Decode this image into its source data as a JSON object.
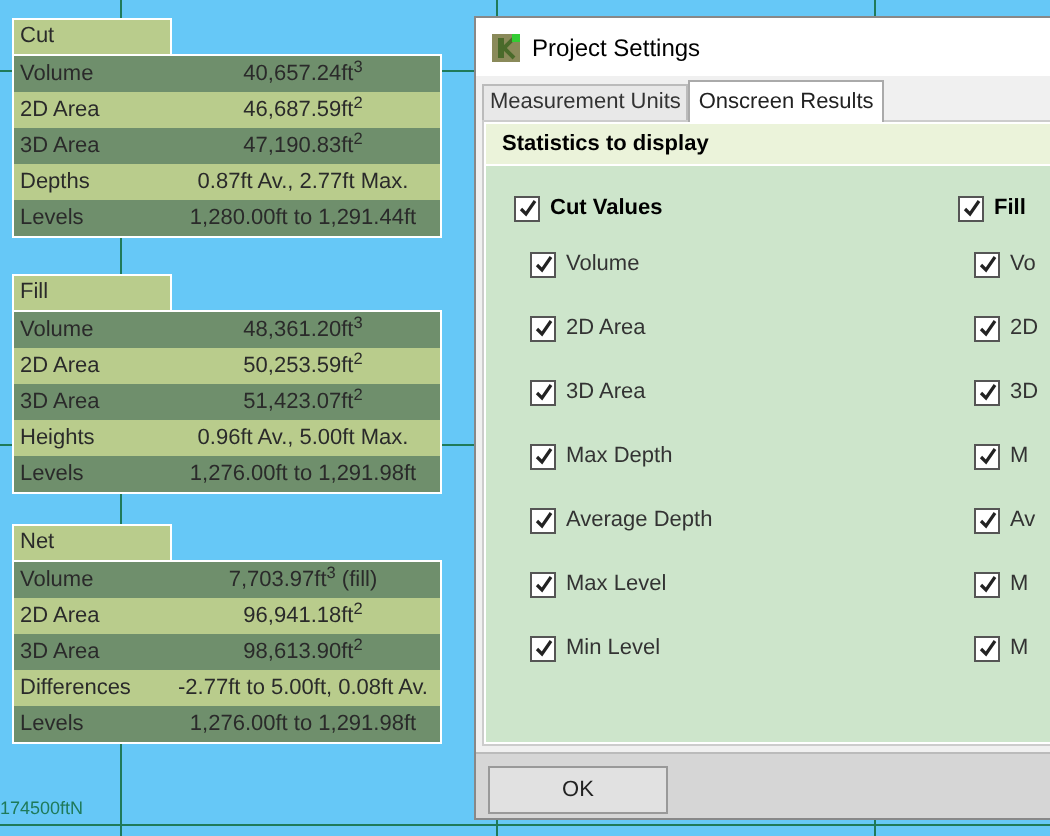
{
  "map": {
    "grid_label": "174500ftN"
  },
  "results": [
    {
      "title": "Cut",
      "rows": [
        {
          "label": "Volume",
          "value": "40,657.24ft$^{3}$"
        },
        {
          "label": "2D Area",
          "value": "46,687.59ft$^{2}$"
        },
        {
          "label": "3D Area",
          "value": "47,190.83ft$^{2}$"
        },
        {
          "label": "Depths",
          "value": "0.87ft Av., 2.77ft Max."
        },
        {
          "label": "Levels",
          "value": "1,280.00ft to 1,291.44ft"
        }
      ]
    },
    {
      "title": "Fill",
      "rows": [
        {
          "label": "Volume",
          "value": "48,361.20ft$^{3}$"
        },
        {
          "label": "2D Area",
          "value": "50,253.59ft$^{2}$"
        },
        {
          "label": "3D Area",
          "value": "51,423.07ft$^{2}$"
        },
        {
          "label": "Heights",
          "value": "0.96ft Av., 5.00ft Max."
        },
        {
          "label": "Levels",
          "value": "1,276.00ft to 1,291.98ft"
        }
      ]
    },
    {
      "title": "Net",
      "rows": [
        {
          "label": "Volume",
          "value": "7,703.97ft$^{3}$ (fill)"
        },
        {
          "label": "2D Area",
          "value": "96,941.18ft$^{2}$"
        },
        {
          "label": "3D Area",
          "value": "98,613.90ft$^{2}$"
        },
        {
          "label": "Differences",
          "value": "-2.77ft to 5.00ft, 0.08ft Av."
        },
        {
          "label": "Levels",
          "value": "1,276.00ft to 1,291.98ft"
        }
      ]
    }
  ],
  "dialog": {
    "title": "Project Settings",
    "tabs": [
      {
        "label": "Measurement Units",
        "selected": false
      },
      {
        "label": "Onscreen Results",
        "selected": true
      }
    ],
    "section": "Statistics to display",
    "columns": [
      {
        "label": "Cut Values",
        "checked": true,
        "items": [
          {
            "label": "Volume",
            "checked": true
          },
          {
            "label": "2D Area",
            "checked": true
          },
          {
            "label": "3D Area",
            "checked": true
          },
          {
            "label": "Max Depth",
            "checked": true
          },
          {
            "label": "Average Depth",
            "checked": true
          },
          {
            "label": "Max Level",
            "checked": true
          },
          {
            "label": "Min Level",
            "checked": true
          }
        ]
      },
      {
        "label": "Fill",
        "checked": true,
        "items": [
          {
            "label": "Vo",
            "checked": true
          },
          {
            "label": "2D",
            "checked": true
          },
          {
            "label": "3D",
            "checked": true
          },
          {
            "label": "M",
            "checked": true
          },
          {
            "label": "Av",
            "checked": true
          },
          {
            "label": "M",
            "checked": true
          },
          {
            "label": "M",
            "checked": true
          }
        ]
      }
    ],
    "buttons": [
      "OK"
    ]
  }
}
